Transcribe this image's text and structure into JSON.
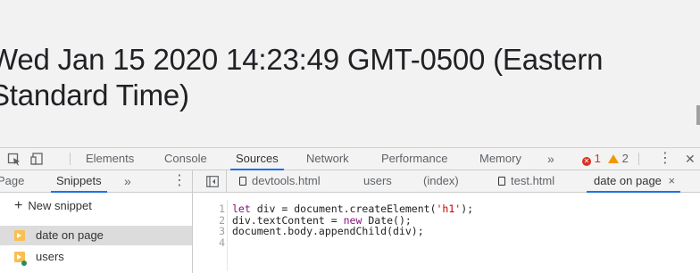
{
  "page": {
    "heading": "Wed Jan 15 2020 14:23:49 GMT-0500 (Eastern Standard Time)"
  },
  "devtools": {
    "main_tabs": [
      "Elements",
      "Console",
      "Sources",
      "Network",
      "Performance",
      "Memory"
    ],
    "active_main_tab": "Sources",
    "more_tabs_label": "»",
    "error_count": "1",
    "warning_count": "2",
    "menu_label": "⋮",
    "close_label": "✕",
    "navigator_tabs": [
      "Page",
      "Snippets"
    ],
    "active_navigator_tab": "Snippets",
    "navigator_more": "»",
    "navigator_menu": "⋮",
    "file_tabs": [
      {
        "label": "devtools.html",
        "has_icon": true
      },
      {
        "label": "users",
        "has_icon": false
      },
      {
        "label": "(index)",
        "has_icon": false
      },
      {
        "label": "test.html",
        "has_icon": true
      },
      {
        "label": "date on page",
        "has_icon": false,
        "active": true,
        "close": "×"
      }
    ],
    "new_snippet_label": "New snippet",
    "snippets": [
      {
        "name": "date on page",
        "selected": true
      },
      {
        "name": "users",
        "selected": false
      }
    ],
    "editor": {
      "line_numbers": [
        "1",
        "2",
        "3",
        "4"
      ],
      "lines": [
        [
          {
            "t": "let",
            "c": "kw"
          },
          {
            "t": " div = document.createElement(",
            "c": "fn"
          },
          {
            "t": "'h1'",
            "c": "str"
          },
          {
            "t": ");",
            "c": "fn"
          }
        ],
        [
          {
            "t": "div.textContent = ",
            "c": "fn"
          },
          {
            "t": "new",
            "c": "kw"
          },
          {
            "t": " Date();",
            "c": "fn"
          }
        ],
        [
          {
            "t": "document.body.appendChild(div);",
            "c": "fn"
          }
        ],
        []
      ]
    }
  },
  "colors": {
    "accent": "#1a73e8",
    "error": "#d93025",
    "warning": "#f29900",
    "snippet_icon": "#f9bf52"
  }
}
